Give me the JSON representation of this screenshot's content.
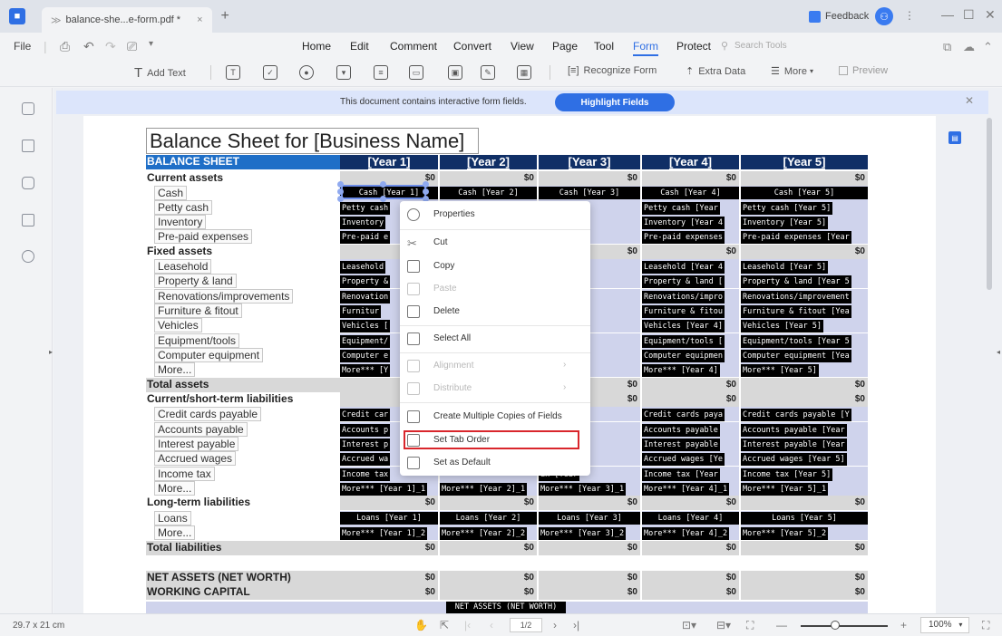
{
  "titlebar": {
    "tab_title": "balance-she...e-form.pdf *",
    "new_tab": "+",
    "close": "×",
    "feedback": "Feedback",
    "more": "⋮",
    "minimize": "—",
    "maximize": "☐",
    "window_close": "✕"
  },
  "menubar": {
    "file": "File",
    "items": [
      "Home",
      "Edit",
      "Comment",
      "Convert",
      "View",
      "Page",
      "Tool",
      "Form",
      "Protect"
    ],
    "active": "Form",
    "search_placeholder": "Search Tools"
  },
  "form_toolbar": {
    "add_text": "Add Text",
    "recognize_form": "Recognize Form",
    "extra_data": "Extra Data",
    "more": "More",
    "preview": "Preview"
  },
  "notice": {
    "text": "This document contains interactive form fields.",
    "button": "Highlight Fields"
  },
  "document": {
    "title": "Balance Sheet for [Business Name]",
    "header_label": "BALANCE SHEET",
    "years": [
      "[Year 1]",
      "[Year 2]",
      "[Year 3]",
      "[Year 4]",
      "[Year 5]"
    ],
    "zero": "$0",
    "rows": {
      "current_assets": "Current assets",
      "cash": "Cash",
      "petty_cash": "Petty cash",
      "inventory": "Inventory",
      "prepaid": "Pre-paid expenses",
      "fixed_assets": "Fixed assets",
      "leasehold": "Leasehold",
      "property": "Property & land",
      "renovations": "Renovations/improvements",
      "furniture": "Furniture & fitout",
      "vehicles": "Vehicles",
      "equipment": "Equipment/tools",
      "computer": "Computer equipment",
      "more": "More...",
      "total_assets": "Total assets",
      "current_liabilities": "Current/short-term liabilities",
      "credit_cards": "Credit cards payable",
      "accounts_payable": "Accounts payable",
      "interest_payable": "Interest payable",
      "accrued_wages": "Accrued wages",
      "income_tax": "Income tax",
      "longterm_liabilities": "Long-term liabilities",
      "loans": "Loans",
      "total_liabilities": "Total liabilities",
      "net_assets": "NET ASSETS (NET WORTH)",
      "working_capital": "WORKING CAPITAL"
    },
    "fields": {
      "cash": [
        "Cash [Year 1]",
        "Cash [Year 2]",
        "Cash [Year 3]",
        "Cash [Year 4]",
        "Cash [Year 5]"
      ],
      "petty": [
        "Petty cash",
        "",
        "sh [Year",
        "Petty cash [Year",
        "Petty cash [Year 5]"
      ],
      "inventory": [
        "Inventory",
        "",
        "[Year 3",
        "Inventory [Year 4",
        "Inventory [Year 5]"
      ],
      "prepaid": [
        "Pre-paid e",
        "",
        "expenses",
        "Pre-paid expenses",
        "Pre-paid expenses [Year"
      ],
      "leasehold": [
        "Leasehold",
        "",
        "l [Year 3",
        "Leasehold [Year 4",
        "Leasehold [Year 5]"
      ],
      "property": [
        "Property &",
        "",
        "& land [",
        "Property & land [",
        "Property & land [Year 5"
      ],
      "renovations": [
        "Renovation",
        "",
        "ns/impro",
        "Renovations/impro",
        "Renovations/improvement"
      ],
      "furniture": [
        "Furnitur",
        "",
        "& fitou",
        "Furniture & fitou",
        "Furniture & fitout [Yea"
      ],
      "vehicles": [
        "Vehicles [",
        "",
        "[Year 3]",
        "Vehicles [Year 4]",
        "Vehicles [Year 5]"
      ],
      "equipment": [
        "Equipment/",
        "",
        "/tools [",
        "Equipment/tools [",
        "Equipment/tools [Year 5"
      ],
      "computer": [
        "Computer e",
        "",
        "equipmen",
        "Computer equipmen",
        "Computer equipment [Yea"
      ],
      "more_assets": [
        "More*** [Y",
        "",
        "Year 3]",
        "More*** [Year 4]",
        "More*** [Year 5]"
      ],
      "credit": [
        "Credit car",
        "",
        "rds paya",
        "Credit cards paya",
        "Credit cards payable [Y"
      ],
      "accounts": [
        "Accounts p",
        "",
        "payable",
        "Accounts payable",
        "Accounts payable [Year"
      ],
      "interest": [
        "Interest p",
        "",
        "payable",
        "Interest payable",
        "Interest payable [Year"
      ],
      "wages": [
        "Accrued wa",
        "",
        "ages [Ye",
        "Accrued wages [Ye",
        "Accrued wages [Year 5]"
      ],
      "tax": [
        "Income tax",
        "",
        "ax [Year",
        "Income tax [Year",
        "Income tax [Year 5]"
      ],
      "more_liab": [
        "More*** [Year 1]_1",
        "More*** [Year 2]_1",
        "More*** [Year 3]_1",
        "More*** [Year 4]_1",
        "More*** [Year 5]_1"
      ],
      "loans": [
        "Loans [Year 1]",
        "Loans [Year 2]",
        "Loans [Year 3]",
        "Loans [Year 4]",
        "Loans [Year 5]"
      ],
      "more_lt": [
        "More*** [Year 1]_2",
        "More*** [Year 2]_2",
        "More*** [Year 3]_2",
        "More*** [Year 4]_2",
        "More*** [Year 5]_2"
      ]
    },
    "bottom_field": "NET ASSETS (NET WORTH)"
  },
  "context_menu": {
    "items": [
      {
        "label": "Properties",
        "enabled": true
      },
      {
        "label": "Cut",
        "enabled": true
      },
      {
        "label": "Copy",
        "enabled": true
      },
      {
        "label": "Paste",
        "enabled": false
      },
      {
        "label": "Delete",
        "enabled": true
      },
      {
        "label": "Select All",
        "enabled": true
      },
      {
        "label": "Alignment",
        "enabled": false
      },
      {
        "label": "Distribute",
        "enabled": false
      },
      {
        "label": "Create Multiple Copies of Fields",
        "enabled": true
      },
      {
        "label": "Set Tab Order",
        "enabled": true,
        "highlighted": true
      },
      {
        "label": "Set as Default",
        "enabled": true
      }
    ]
  },
  "statusbar": {
    "page_size": "29.7 x 21 cm",
    "page_indicator": "1/2",
    "zoom": "100%"
  },
  "colors": {
    "accent": "#2f6fe4",
    "header_blue": "#1f6fc7",
    "header_navy": "#102f66",
    "field_bg": "#cfd3ec",
    "highlight_red": "#d9262c"
  }
}
